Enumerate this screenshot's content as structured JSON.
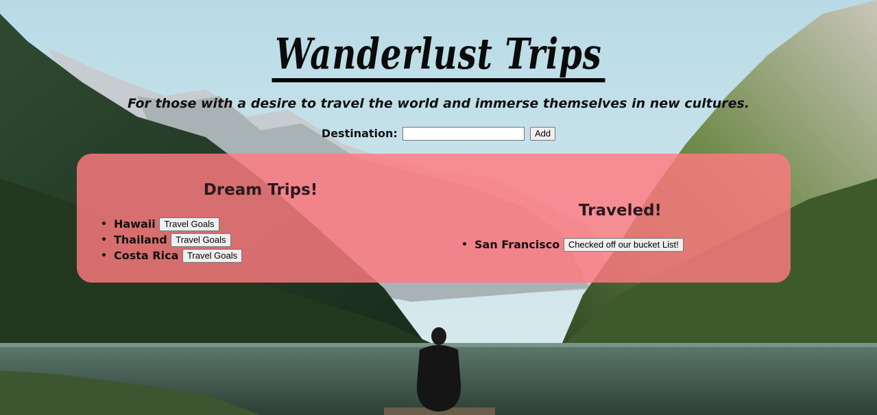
{
  "header": {
    "title": "Wanderlust Trips",
    "tagline": "For those with a desire to travel the world and immerse themselves in new cultures."
  },
  "add_form": {
    "label": "Destination:",
    "value": "",
    "placeholder": "",
    "button_label": "Add"
  },
  "dream": {
    "heading": "Dream Trips!",
    "items": [
      {
        "name": "Hawaii",
        "button": "Travel Goals"
      },
      {
        "name": "Thailand",
        "button": "Travel Goals"
      },
      {
        "name": "Costa Rica",
        "button": "Travel Goals"
      }
    ]
  },
  "traveled": {
    "heading": "Traveled!",
    "items": [
      {
        "name": "San Francisco",
        "button": "Checked off our bucket List!"
      }
    ]
  },
  "colors": {
    "panel": "#ff7a80",
    "title": "#0b0b0b",
    "heading": "#2a1a1e"
  }
}
